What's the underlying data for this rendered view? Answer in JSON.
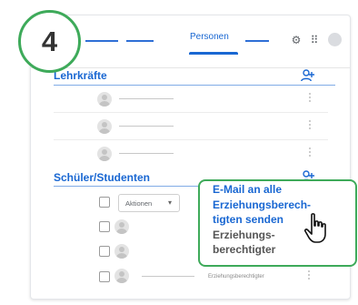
{
  "step": {
    "number": "4"
  },
  "tabs": {
    "active_label": "Personen"
  },
  "teachers": {
    "heading": "Lehrkräfte",
    "rows": [
      {},
      {},
      {}
    ]
  },
  "students": {
    "heading": "Schüler/Studenten",
    "actions_label": "Aktionen",
    "guardian_label": "Erziehungsberechtigter"
  },
  "popup_menu": {
    "email_all_guardians": "E-Mail an alle\nErziehungsberech-\ntigten senden",
    "guardian": "Erziehungs-\nberechtigter"
  },
  "colors": {
    "accent": "#1967d2",
    "highlight": "#3eaa5a"
  }
}
